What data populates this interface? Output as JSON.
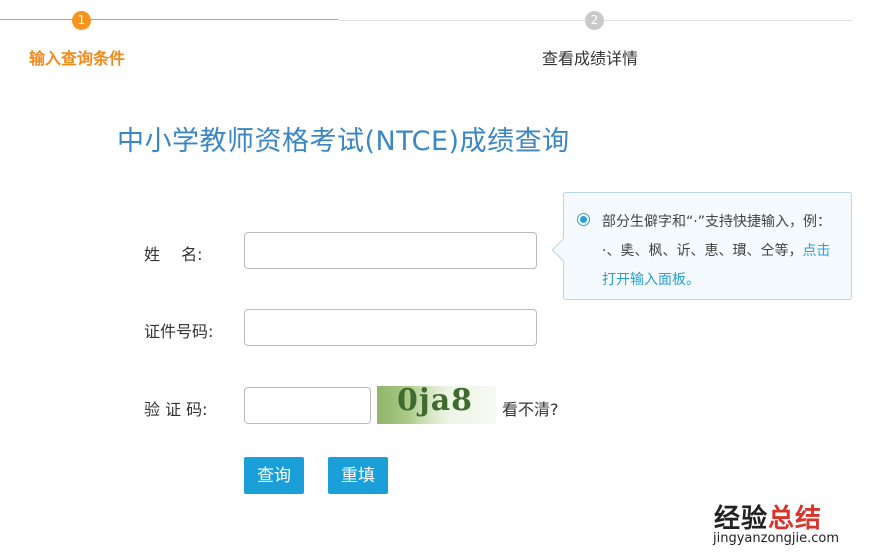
{
  "steps": [
    {
      "number": "1",
      "label": "输入查询条件"
    },
    {
      "number": "2",
      "label": "查看成绩详情"
    }
  ],
  "page_title": "中小学教师资格考试(NTCE)成绩查询",
  "form": {
    "name_label": "姓　 名:",
    "id_label": "证件号码:",
    "captcha_label": "验 证 码:",
    "name_value": "",
    "id_value": "",
    "captcha_value": "",
    "captcha_image_text": "0ja8",
    "refresh_label": "看不清?",
    "query_button": "查询",
    "reset_button": "重填"
  },
  "tooltip": {
    "text": "部分生僻字和“·”支持快捷输入，例：·、奊、枫、䜣、恵、瑻、仝等，",
    "link": "点击打开输入面板。"
  },
  "watermark": {
    "cn_black": "经验",
    "cn_red": "总结",
    "en": "jingyanzongjie.com"
  },
  "colors": {
    "accent_orange": "#f7931e",
    "title_blue": "#3c86c2",
    "button_blue": "#1a9fd9",
    "link_blue": "#2a9fd6"
  }
}
